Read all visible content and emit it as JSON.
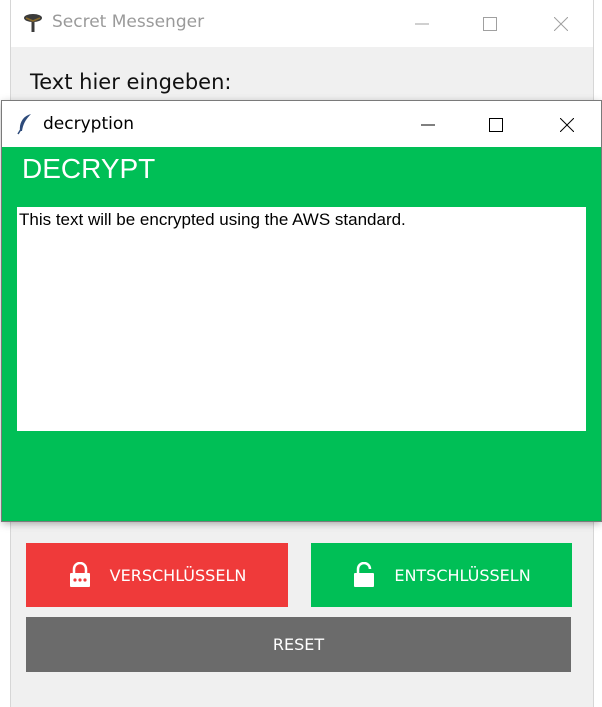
{
  "back_window": {
    "title": "Secret Messenger",
    "label": "Text hier eingeben:",
    "buttons": {
      "encrypt": "VERSCHLÜSSELN",
      "decrypt": "ENTSCHLÜSSELN",
      "reset": "RESET"
    }
  },
  "front_window": {
    "title": "decryption",
    "heading": "DECRYPT",
    "text": "This text will be encrypted using the AWS standard."
  },
  "colors": {
    "encrypt": "#ef3a3a",
    "decrypt": "#00bf56",
    "reset": "#6b6b6b",
    "window_background": "#00bf56"
  },
  "icons": {
    "back_window": "tree-app-icon",
    "front_window": "feather-icon",
    "encrypt": "lock-icon",
    "decrypt": "unlock-icon"
  }
}
